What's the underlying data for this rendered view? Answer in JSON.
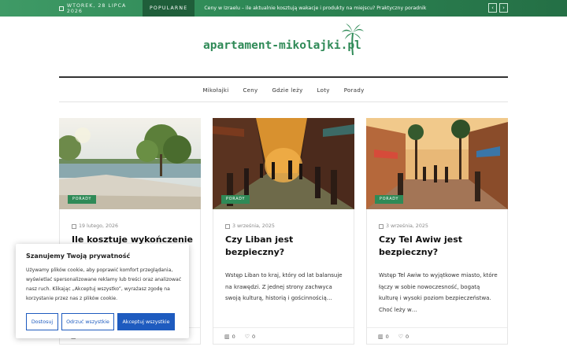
{
  "topbar": {
    "date": "WTOREK, 28 LIPCA 2026",
    "popular_label": "POPULARNE",
    "ticker": "Ceny w Izraelu – ile aktualnie kosztują wakacje i produkty na miejscu? Praktyczny poradnik",
    "prev_icon": "‹",
    "next_icon": "›"
  },
  "site": {
    "logo_text": "apartament-mikolajki.pl",
    "logo_icon": "palm-tree-icon"
  },
  "nav": {
    "items": [
      "Mikołajki",
      "Ceny",
      "Gdzie leży",
      "Loty",
      "Porady"
    ]
  },
  "cards": [
    {
      "tag": "PORADY",
      "date": "19 lutego, 2026",
      "title": "Ile kosztuje wykończenie",
      "excerpt": "",
      "stats": "0",
      "likes": "0"
    },
    {
      "tag": "PORADY",
      "date": "3 września, 2025",
      "title": "Czy Liban jest bezpieczny?",
      "excerpt": "Wstęp Liban to kraj, który od lat balansuje na krawędzi. Z jednej strony zachwyca swoją kulturą, historią i gościnnością…",
      "stats": "0",
      "likes": "0"
    },
    {
      "tag": "PORADY",
      "date": "3 września, 2025",
      "title": "Czy Tel Awiw jest bezpieczny?",
      "excerpt": "Wstęp Tel Awiw to wyjątkowe miasto, które łączy w sobie nowoczesność, bogatą kulturę i wysoki poziom bezpieczeństwa. Choć leży w…",
      "stats": "0",
      "likes": "0"
    }
  ],
  "cookie": {
    "title": "Szanujemy Twoją prywatność",
    "text": "Używamy plików cookie, aby poprawić komfort przeglądania, wyświetlać spersonalizowane reklamy lub treści oraz analizować nasz ruch. Klikając „Akceptuj wszystko”, wyrażasz zgodę na korzystanie przez nas z plików cookie.",
    "customize": "Dostosuj",
    "reject": "Odrzuć wszystkie",
    "accept": "Akceptuj wszystkie"
  },
  "colors": {
    "brand_green": "#2f8a57",
    "cookie_blue": "#1e5bbf"
  }
}
